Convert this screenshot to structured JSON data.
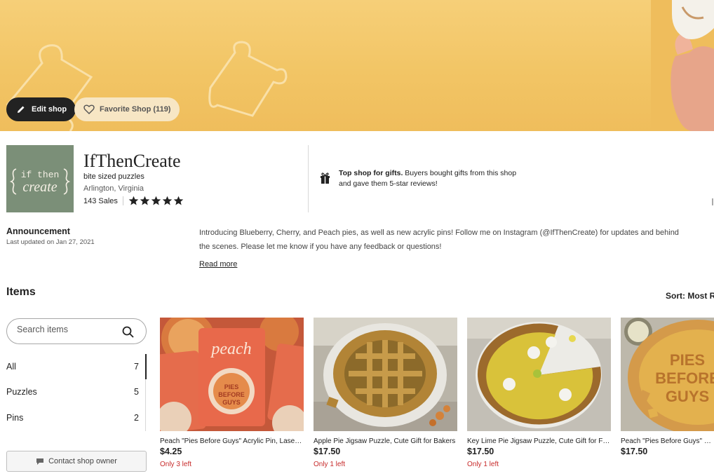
{
  "banner": {
    "edit_label": "Edit shop",
    "favorite_label": "Favorite Shop (119)",
    "colors": {
      "background": "#f2c565",
      "edit_button": "#222222",
      "favorite_button": "#f7e6c4"
    }
  },
  "shop": {
    "logo_text_top": "if then",
    "logo_text_bottom": "create",
    "name": "IfThenCreate",
    "tagline": "bite sized puzzles",
    "location": "Arlington, Virginia",
    "sales": "143 Sales",
    "rating": 5,
    "top_shop_bold": "Top shop for gifts.",
    "top_shop_text": " Buyers bought gifts from this shop and gave them 5-star reviews!"
  },
  "announcement": {
    "title": "Announcement",
    "updated": "Last updated on Jan 27, 2021",
    "text": "Introducing Blueberry, Cherry, and Peach pies, as well as new acrylic pins! Follow me on Instagram (@IfThenCreate) for updates and behind the scenes. Please let me know if you have any feedback or questions!",
    "read_more": "Read more"
  },
  "items": {
    "title": "Items",
    "sort_label": "Sort: Most R",
    "search_placeholder": "Search items",
    "categories": [
      {
        "label": "All",
        "count": "7"
      },
      {
        "label": "Puzzles",
        "count": "5"
      },
      {
        "label": "Pins",
        "count": "2"
      }
    ],
    "contact_label": "Contact shop owner",
    "listings": [
      {
        "title": "Peach \"Pies Before Guys\" Acrylic Pin, Laser Cut",
        "price": "$4.25",
        "stock": "Only 3 left",
        "image": "peach-pin-photo"
      },
      {
        "title": "Apple Pie Jigsaw Puzzle, Cute Gift for Bakers",
        "price": "$17.50",
        "stock": "Only 1 left",
        "image": "apple-pie-puzzle-photo"
      },
      {
        "title": "Key Lime Pie Jigsaw Puzzle, Cute Gift for Foodies",
        "price": "$17.50",
        "stock": "Only 1 left",
        "image": "key-lime-pie-puzzle-photo"
      },
      {
        "title": "Peach \"Pies Before Guys\" Jigsaw Puzzle",
        "price": "$17.50",
        "stock": "",
        "image": "peach-pie-puzzle-photo"
      }
    ]
  },
  "icons": {
    "edit": "pencil-icon",
    "favorite": "heart-icon",
    "gift": "gift-icon",
    "search": "search-icon",
    "contact": "chat-icon",
    "star": "star-icon"
  },
  "colors": {
    "stock_warning": "#c72a2a",
    "logo_bg": "#7b8f78",
    "text": "#222222"
  }
}
